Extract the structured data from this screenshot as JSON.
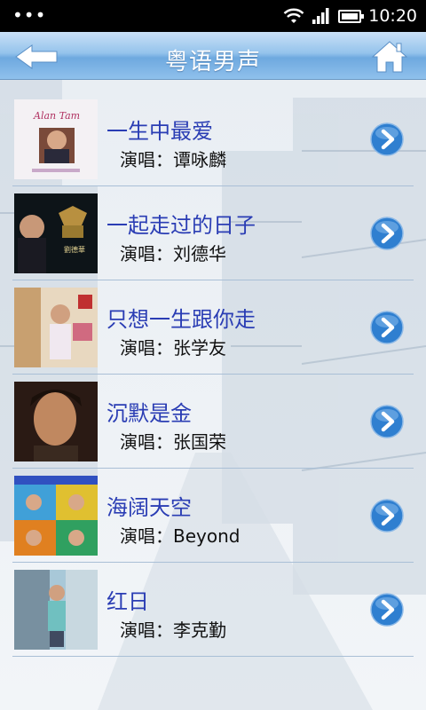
{
  "status_bar": {
    "time": "10:20",
    "icons": [
      "menu-dots-icon",
      "wifi-icon",
      "signal-icon",
      "battery-icon"
    ]
  },
  "header": {
    "title": "粤语男声",
    "back_icon": "back-arrow-icon",
    "home_icon": "home-icon"
  },
  "songs": [
    {
      "title": "一生中最爱",
      "artist": "演唱：谭咏麟"
    },
    {
      "title": "一起走过的日子",
      "artist": "演唱：刘德华"
    },
    {
      "title": "只想一生跟你走",
      "artist": "演唱：张学友"
    },
    {
      "title": "沉默是金",
      "artist": "演唱：张国荣"
    },
    {
      "title": "海阔天空",
      "artist": "演唱：Beyond"
    },
    {
      "title": "红日",
      "artist": "演唱：李克勤"
    }
  ],
  "colors": {
    "header_gradient_top": "#c9e0f6",
    "header_gradient_bottom": "#6ea9df",
    "title_text": "#2a3db4",
    "arrow_button": "#2f7fd0"
  }
}
